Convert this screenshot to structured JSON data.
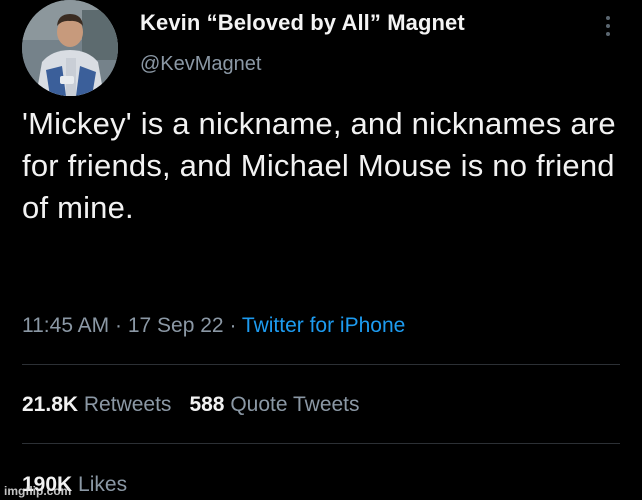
{
  "tweet": {
    "display_name": "Kevin “Beloved by All” Magnet",
    "handle": "@KevMagnet",
    "text": "'Mickey' is a nickname, and nicknames are for friends, and Michael Mouse is no friend of mine.",
    "meta": {
      "time": "11:45 AM",
      "separator1": " · ",
      "date": "17 Sep 22",
      "separator2": " · ",
      "source": "Twitter for iPhone"
    },
    "stats": {
      "retweets_count": "21.8K",
      "retweets_label": "Retweets",
      "quotes_count": "588",
      "quotes_label": "Quote Tweets",
      "likes_count": "190K",
      "likes_label": "Likes"
    },
    "icons": {
      "more": "more-vertical-icon",
      "avatar": "profile-photo"
    }
  },
  "watermark": "imgflip.com",
  "colors": {
    "background": "#000000",
    "text": "#f2f2f2",
    "secondary": "#8b98a5",
    "link": "#1d9bf0",
    "divider": "#2c3035"
  }
}
